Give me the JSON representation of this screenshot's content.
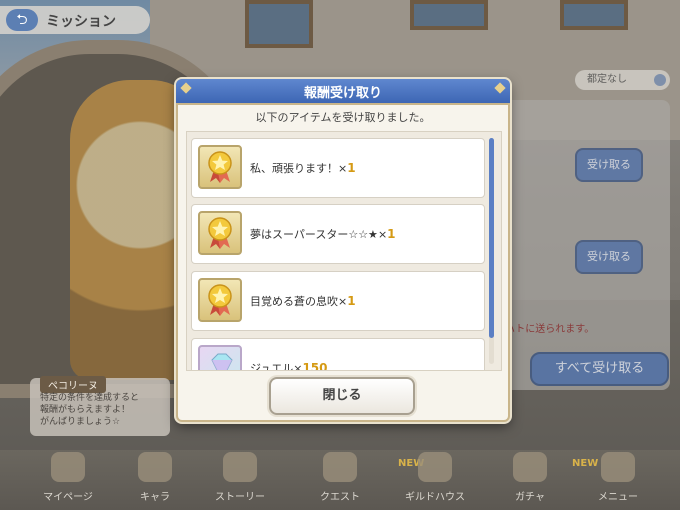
{
  "header": {
    "back_icon": "back-arrow-icon",
    "title": "ミッション"
  },
  "background": {
    "sort_label": "都定なし",
    "claim_button_label": "受け取る",
    "claim_all_label": "すべて受け取る",
    "note_text": "ハトに送られます。",
    "info_title": "ペコリーヌ",
    "info_text": "特定の条件を達成すると\n報酬がもらえますよ！\nがんばりましょう☆"
  },
  "modal": {
    "title": "報酬受け取り",
    "message": "以下のアイテムを受け取りました。",
    "rewards": [
      {
        "name": "私、頑張ります！",
        "quantity": "1",
        "icon": "gold-star-medal-icon"
      },
      {
        "name": "夢はスーパースター☆☆★",
        "quantity": "1",
        "icon": "gold-star-medal-icon"
      },
      {
        "name": "目覚める蒼の息吹",
        "quantity": "1",
        "icon": "gold-star-medal-icon"
      },
      {
        "name": "ジュエル",
        "quantity": "150",
        "icon": "jewel-icon"
      }
    ],
    "close_label": "閉じる",
    "accent_color": "#3d66b4"
  },
  "nav": {
    "items": [
      {
        "label": "マイページ",
        "icon": "home-icon"
      },
      {
        "label": "キャラ",
        "icon": "character-icon"
      },
      {
        "label": "ストーリー",
        "icon": "story-icon"
      },
      {
        "label": "クエスト",
        "icon": "quest-sword-icon"
      },
      {
        "label": "ギルドハウス",
        "icon": "guild-house-icon"
      },
      {
        "label": "ガチャ",
        "icon": "gacha-icon"
      },
      {
        "label": "メニュー",
        "icon": "menu-icon"
      }
    ],
    "new_badge": "NEW"
  }
}
